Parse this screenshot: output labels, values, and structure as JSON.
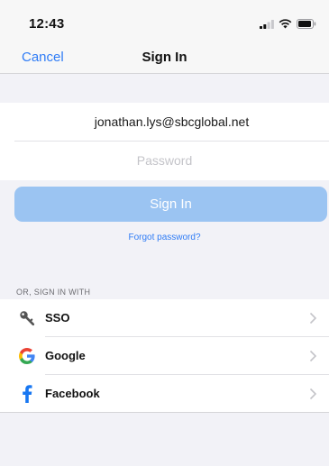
{
  "status_bar": {
    "time": "12:43",
    "icons": [
      "signal-icon",
      "wifi-icon",
      "battery-icon"
    ]
  },
  "nav": {
    "cancel_label": "Cancel",
    "title": "Sign In"
  },
  "form": {
    "email_value": "jonathan.lys@sbcglobal.net",
    "password_placeholder": "Password",
    "signin_label": "Sign In",
    "forgot_label": "Forgot password?"
  },
  "providers": {
    "header": "OR, SIGN IN WITH",
    "items": [
      {
        "label": "SSO",
        "icon": "key-icon"
      },
      {
        "label": "Google",
        "icon": "google-icon"
      },
      {
        "label": "Facebook",
        "icon": "facebook-icon"
      }
    ]
  },
  "colors": {
    "accent": "#2f7cf6",
    "button_disabled": "#9bc4f2",
    "background": "#f2f2f7",
    "facebook": "#1877f2"
  }
}
